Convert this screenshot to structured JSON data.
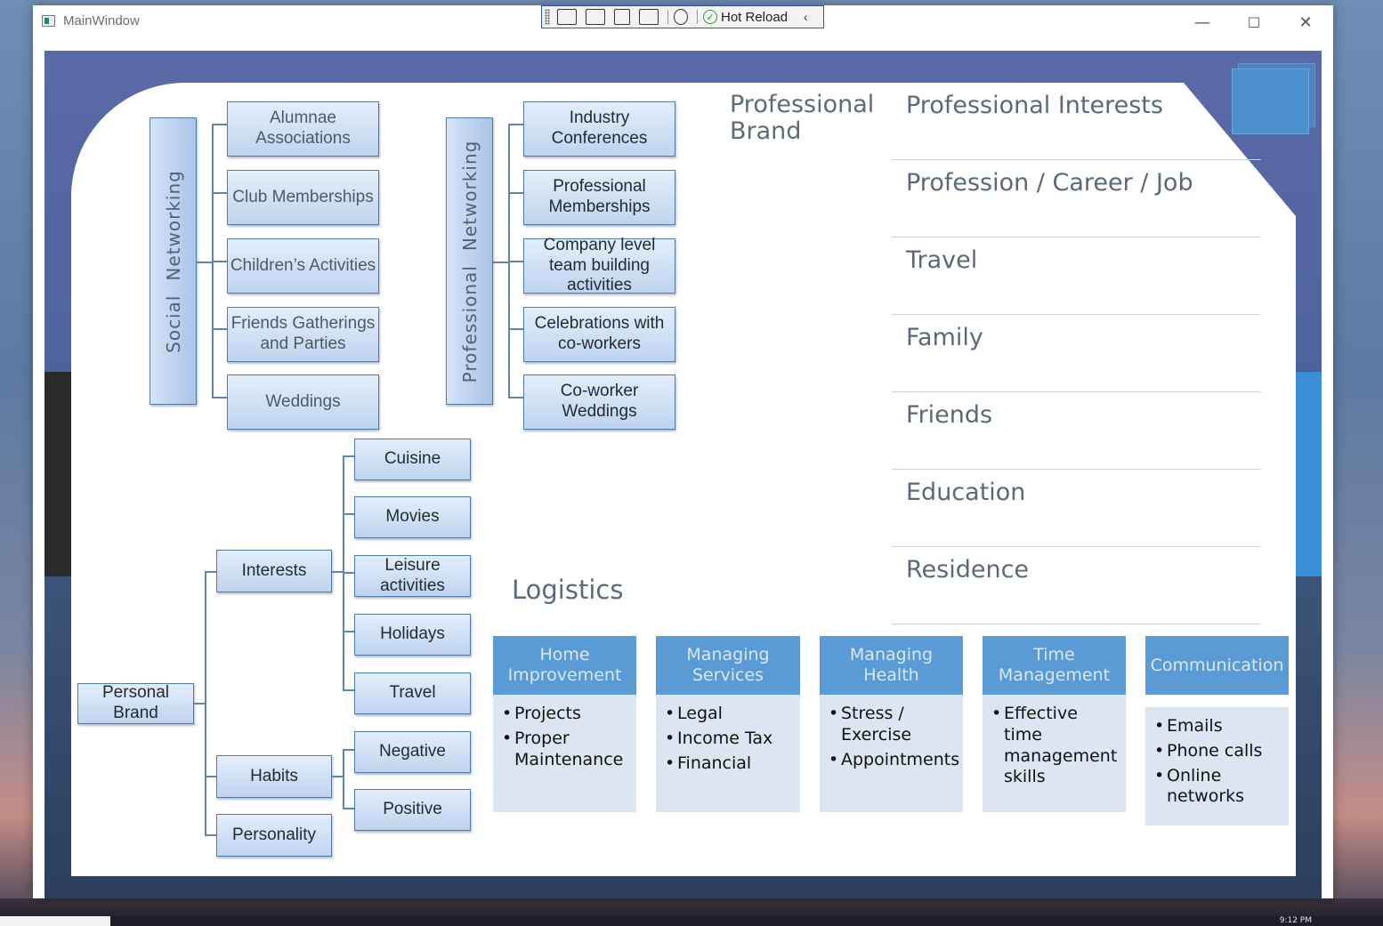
{
  "window": {
    "title": "MainWindow",
    "minimize": "—",
    "maximize": "☐",
    "close": "✕"
  },
  "toolbar": {
    "hot_reload_label": "Hot Reload",
    "collapse": "‹",
    "check": "✓"
  },
  "social_networking": {
    "label_a": "Social",
    "label_b": "Networking",
    "items": [
      "Alumnae Associations",
      "Club Memberships",
      "Children’s Activities",
      "Friends Gatherings and Parties",
      "Weddings"
    ]
  },
  "professional_networking": {
    "label_a": "Professional",
    "label_b": "Networking",
    "items": [
      "Industry Conferences",
      "Professional Memberships",
      "Company level team building activities",
      "Celebrations with co-workers",
      "Co-worker Weddings"
    ]
  },
  "professional_brand": {
    "heading": "Professional Brand",
    "items": [
      "Professional Interests",
      "Profession / Career / Job",
      "Travel",
      "Family",
      "Friends",
      "Education",
      "Residence"
    ]
  },
  "personal_brand": {
    "root": "Personal Brand",
    "interests": "Interests",
    "interest_items": [
      "Cuisine",
      "Movies",
      "Leisure activities",
      "Holidays",
      "Travel"
    ],
    "habits": "Habits",
    "habit_items": [
      "Negative",
      "Positive"
    ],
    "personality": "Personality"
  },
  "logistics": {
    "heading": "Logistics",
    "cards": [
      {
        "title": "Home Improvement",
        "items": [
          "Projects",
          "Proper Maintenance"
        ]
      },
      {
        "title": "Managing Services",
        "items": [
          "Legal",
          "Income Tax",
          "Financial"
        ]
      },
      {
        "title": "Managing Health",
        "items": [
          "Stress / Exercise",
          "Appointments"
        ]
      },
      {
        "title": "Time Management",
        "items": [
          "Effective time management skills"
        ]
      },
      {
        "title": "Communication",
        "items": [
          "Emails",
          "Phone calls",
          "Online networks"
        ]
      }
    ]
  },
  "taskbar": {
    "clock": "9:12 PM"
  }
}
